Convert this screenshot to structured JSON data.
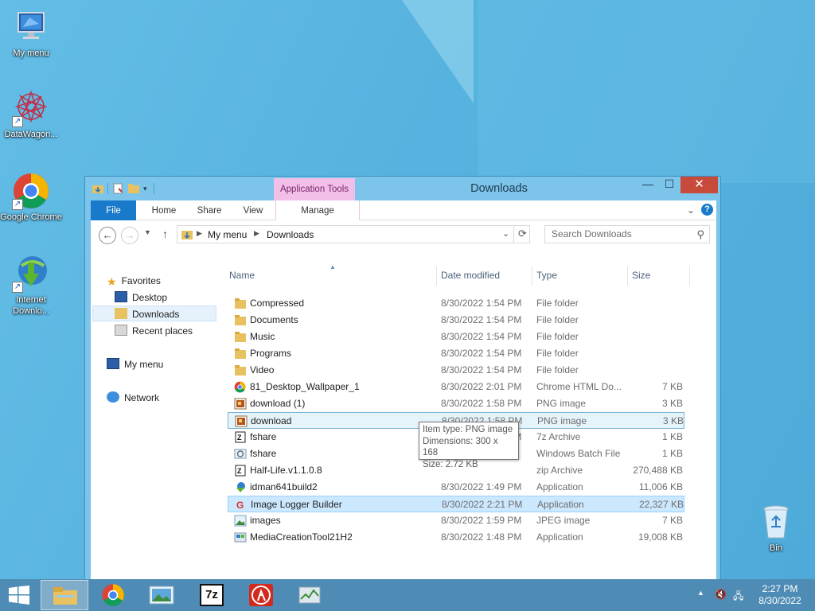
{
  "desktop": {
    "icons": [
      {
        "label": "My menu"
      },
      {
        "label": "DataWagon..."
      },
      {
        "label": "Google Chrome"
      },
      {
        "label": "Internet Downlo..."
      },
      {
        "label": "Bin"
      }
    ]
  },
  "window": {
    "title": "Downloads",
    "app_tools_label": "Application Tools",
    "controls": {
      "minimize": "—",
      "maximize": "☐",
      "close": "✕"
    }
  },
  "ribbon": {
    "tabs": {
      "file": "File",
      "home": "Home",
      "share": "Share",
      "view": "View",
      "manage": "Manage"
    },
    "help": "?"
  },
  "address_bar": {
    "crumbs": [
      "My menu",
      "Downloads"
    ],
    "search_placeholder": "Search Downloads"
  },
  "nav_pane": {
    "favorites": "Favorites",
    "desktop": "Desktop",
    "downloads": "Downloads",
    "recent": "Recent places",
    "mymenu": "My menu",
    "network": "Network"
  },
  "columns": {
    "name": "Name",
    "date": "Date modified",
    "type": "Type",
    "size": "Size"
  },
  "files": [
    {
      "name": "Compressed",
      "date": "8/30/2022 1:54 PM",
      "type": "File folder",
      "size": "",
      "icon": "folder"
    },
    {
      "name": "Documents",
      "date": "8/30/2022 1:54 PM",
      "type": "File folder",
      "size": "",
      "icon": "folder"
    },
    {
      "name": "Music",
      "date": "8/30/2022 1:54 PM",
      "type": "File folder",
      "size": "",
      "icon": "folder"
    },
    {
      "name": "Programs",
      "date": "8/30/2022 1:54 PM",
      "type": "File folder",
      "size": "",
      "icon": "folder"
    },
    {
      "name": "Video",
      "date": "8/30/2022 1:54 PM",
      "type": "File folder",
      "size": "",
      "icon": "folder"
    },
    {
      "name": "81_Desktop_Wallpaper_1",
      "date": "8/30/2022 2:01 PM",
      "type": "Chrome HTML Do...",
      "size": "7 KB",
      "icon": "chrome"
    },
    {
      "name": "download (1)",
      "date": "8/30/2022 1:58 PM",
      "type": "PNG image",
      "size": "3 KB",
      "icon": "png"
    },
    {
      "name": "download",
      "date": "8/30/2022 1:58 PM",
      "type": "PNG image",
      "size": "3 KB",
      "icon": "png"
    },
    {
      "name": "fshare",
      "date": "8/30/2022 2:05 PM",
      "type": "7z Archive",
      "size": "1 KB",
      "icon": "archive"
    },
    {
      "name": "fshare",
      "date": "",
      "type": "Windows Batch File",
      "size": "1 KB",
      "icon": "batch"
    },
    {
      "name": "Half-Life.v1.1.0.8",
      "date": "",
      "type": "zip Archive",
      "size": "270,488 KB",
      "icon": "archive"
    },
    {
      "name": "idman641build2",
      "date": "8/30/2022 1:49 PM",
      "type": "Application",
      "size": "11,006 KB",
      "icon": "app"
    },
    {
      "name": "Image Logger Builder",
      "date": "8/30/2022 2:21 PM",
      "type": "Application",
      "size": "22,327 KB",
      "icon": "google"
    },
    {
      "name": "images",
      "date": "8/30/2022 1:59 PM",
      "type": "JPEG image",
      "size": "7 KB",
      "icon": "jpeg"
    },
    {
      "name": "MediaCreationTool21H2",
      "date": "8/30/2022 1:48 PM",
      "type": "Application",
      "size": "19,008 KB",
      "icon": "media"
    }
  ],
  "tooltip": {
    "line1": "Item type: PNG image",
    "line2": "Dimensions: 300 x 168",
    "line3": "Size: 2.72 KB"
  },
  "taskbar": {
    "time": "2:27 PM",
    "date": "8/30/2022",
    "app_7z_label": "7z"
  }
}
